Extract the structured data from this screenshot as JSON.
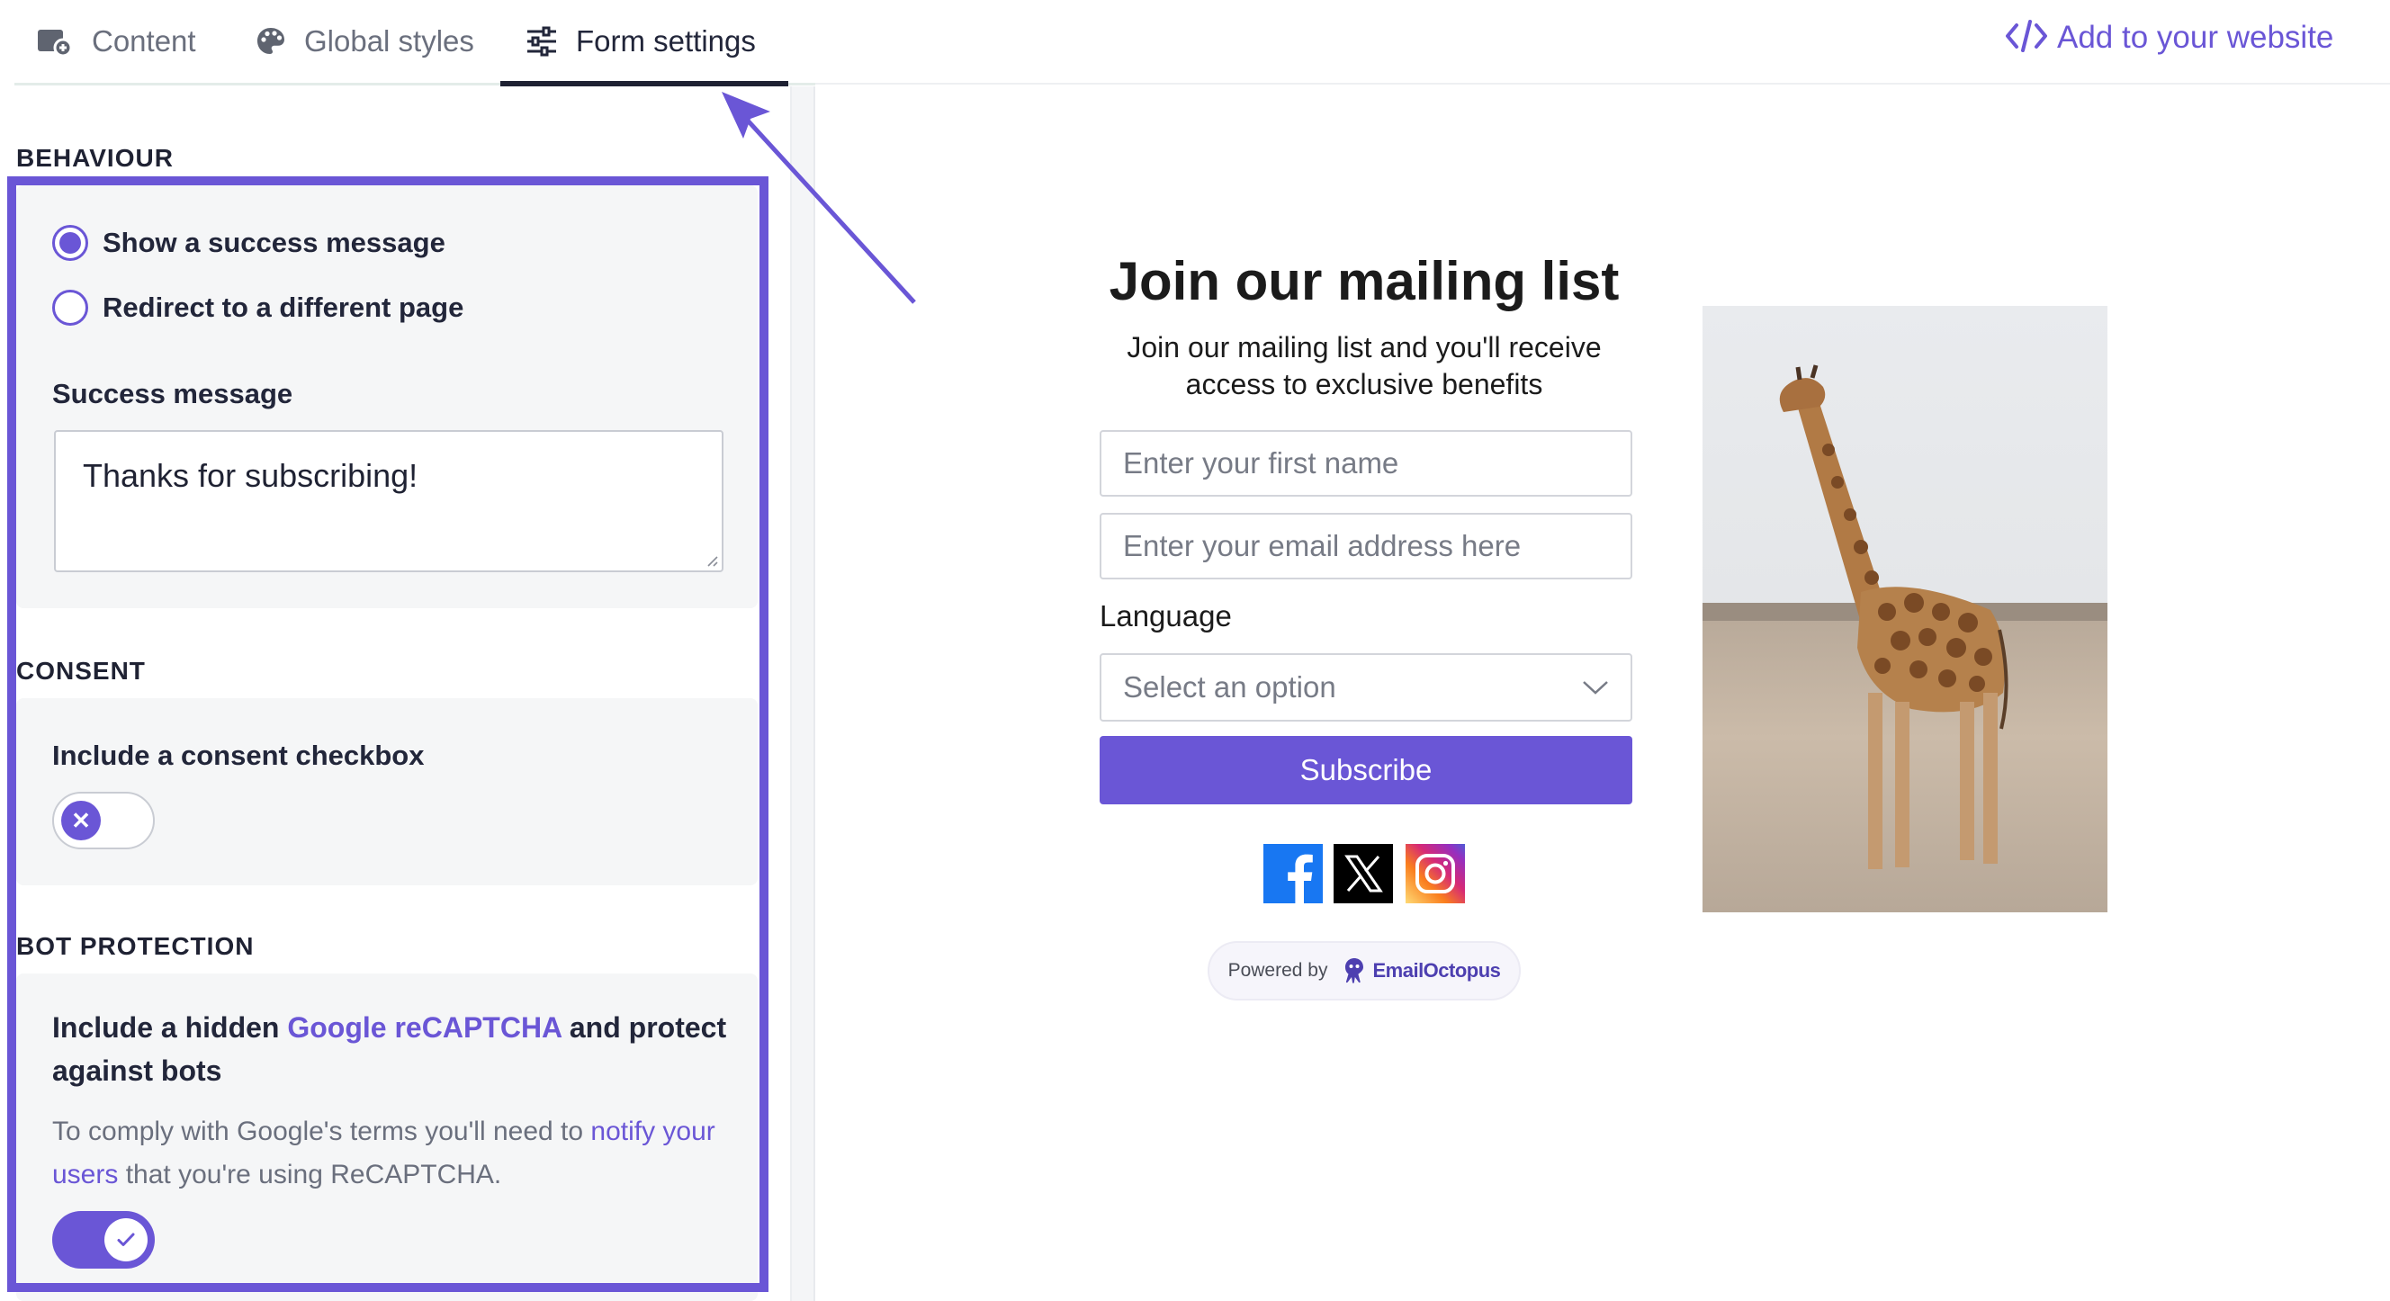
{
  "tabs": [
    {
      "label": "Content",
      "icon": "content-camera-icon",
      "active": false
    },
    {
      "label": "Global styles",
      "icon": "palette-icon",
      "active": false
    },
    {
      "label": "Form settings",
      "icon": "sliders-icon",
      "active": true
    }
  ],
  "header": {
    "add_to_website_label": "Add to your website",
    "add_icon": "code-icon"
  },
  "behaviour": {
    "heading": "BEHAVIOUR",
    "options": [
      {
        "label": "Show a success message",
        "selected": true
      },
      {
        "label": "Redirect to a different page",
        "selected": false
      }
    ],
    "success_message_label": "Success message",
    "success_message_value": "Thanks for subscribing!"
  },
  "consent": {
    "heading": "CONSENT",
    "checkbox_label": "Include a consent checkbox",
    "enabled": false
  },
  "bot_protection": {
    "heading": "BOT PROTECTION",
    "title_prefix": "Include a hidden ",
    "title_link": "Google reCAPTCHA",
    "title_suffix": " and protect against bots",
    "note_prefix": "To comply with Google's terms you'll need to ",
    "note_link": "notify your users",
    "note_suffix": " that you're using ReCAPTCHA.",
    "enabled": true
  },
  "preview": {
    "title": "Join our mailing list",
    "subtitle": "Join our mailing list and you'll receive access to exclusive benefits",
    "first_name_placeholder": "Enter your first name",
    "email_placeholder": "Enter your email address here",
    "language_label": "Language",
    "language_select_value": "Select an option",
    "subscribe_label": "Subscribe",
    "social_icons": [
      "facebook-icon",
      "x-icon",
      "instagram-icon"
    ],
    "powered_by_label": "Powered by",
    "brand_name": "EmailOctopus",
    "image": "giraffe-photo"
  },
  "colors": {
    "accent": "#6a56d6",
    "text_dark": "#1f2233",
    "panel_bg": "#f5f6f7"
  }
}
